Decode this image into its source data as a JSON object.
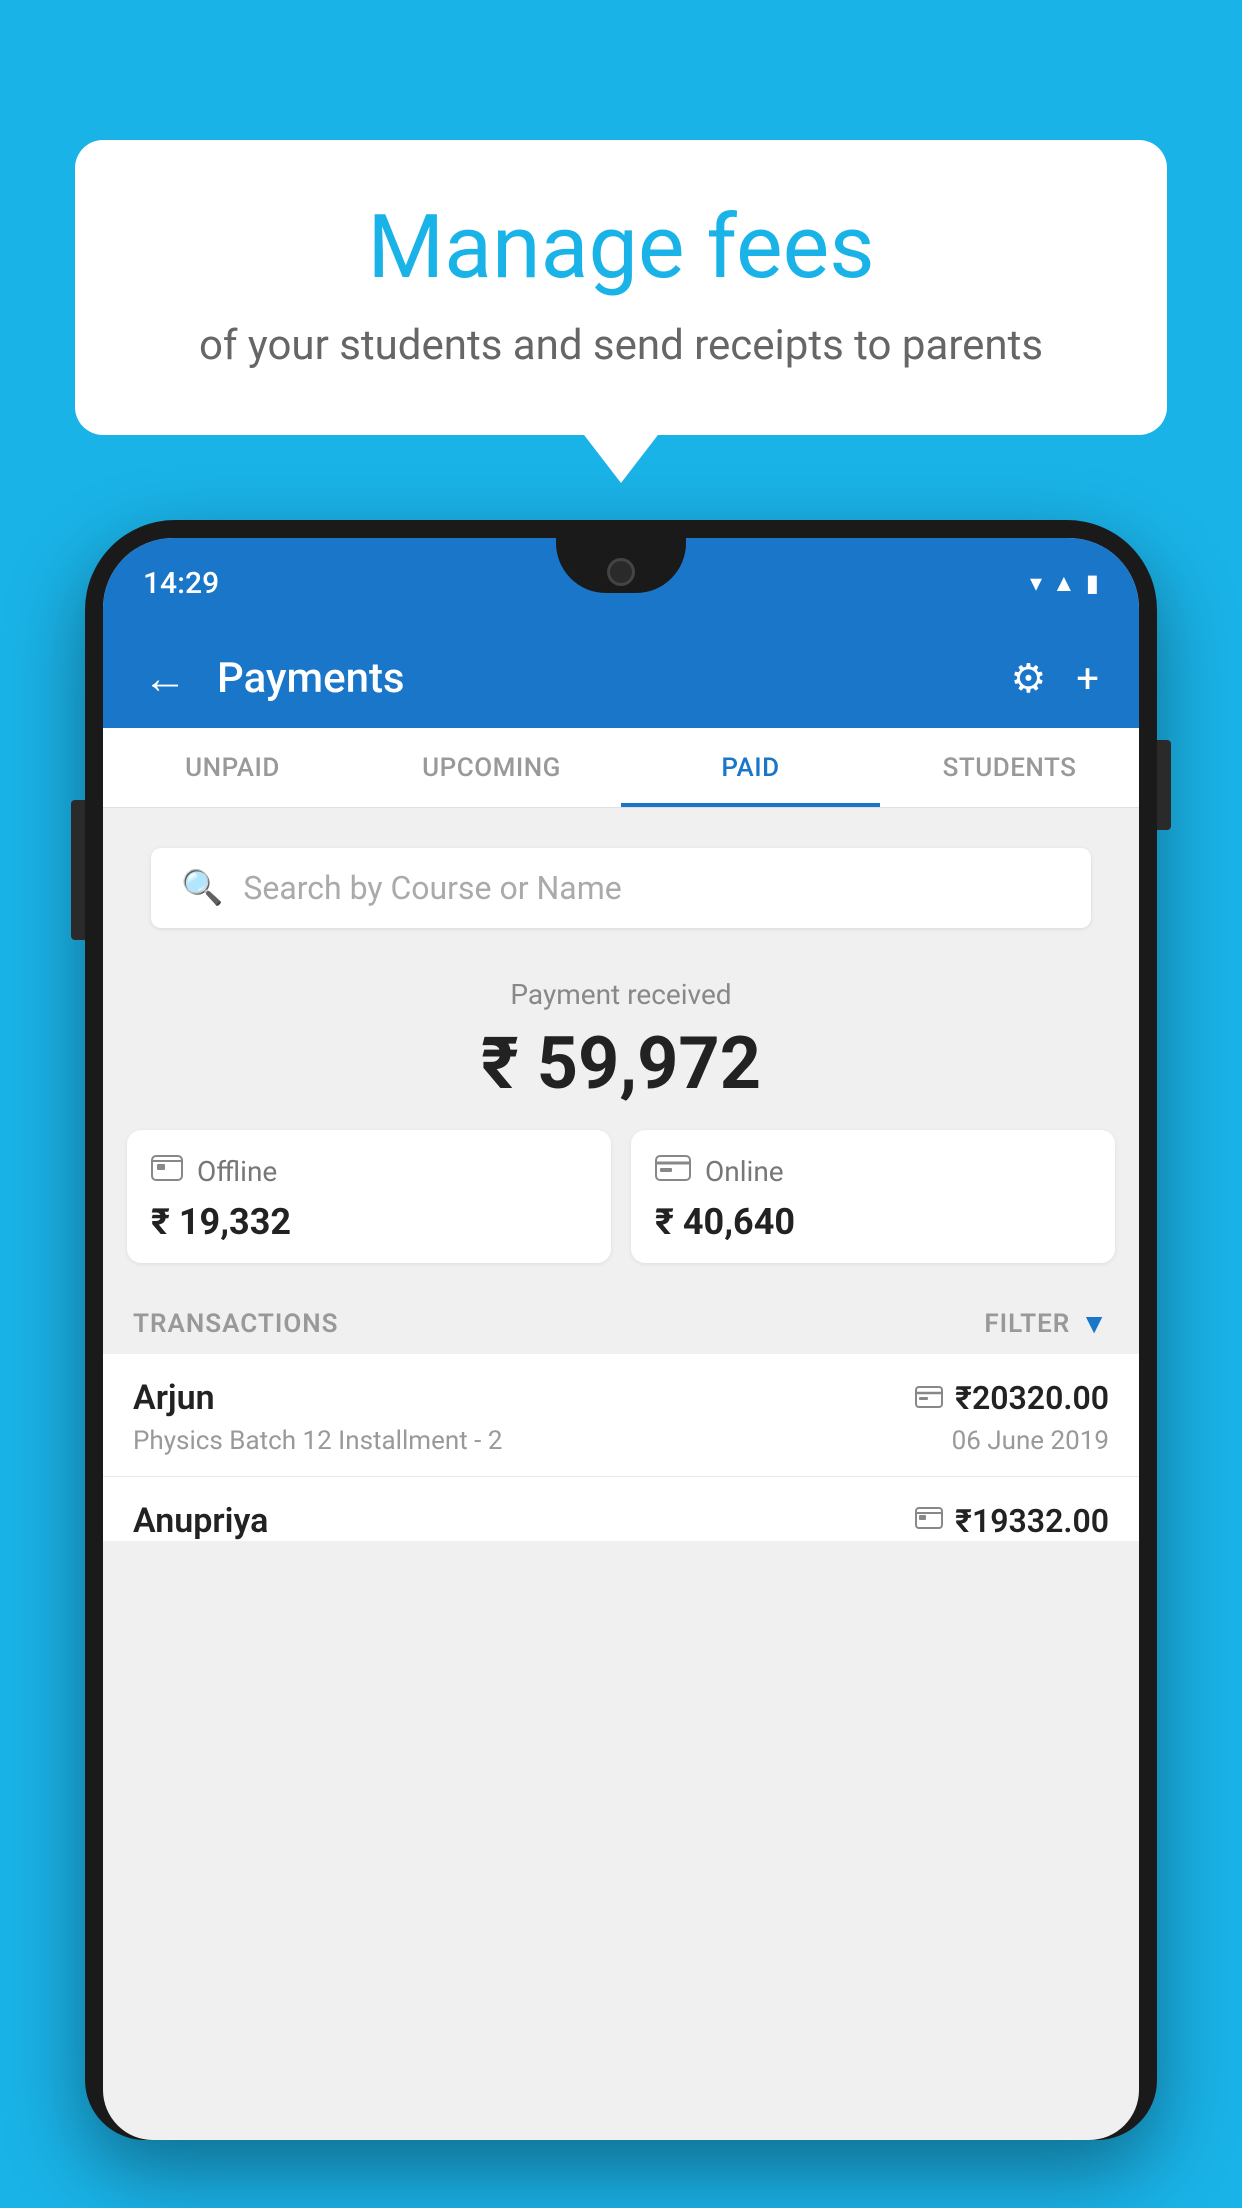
{
  "background_color": "#1ab3e8",
  "bubble": {
    "title": "Manage fees",
    "subtitle": "of your students and send receipts to parents"
  },
  "status_bar": {
    "time": "14:29",
    "icons": [
      "wifi",
      "signal",
      "battery"
    ]
  },
  "app_header": {
    "title": "Payments",
    "back_label": "←",
    "settings_label": "⚙",
    "add_label": "+"
  },
  "tabs": [
    {
      "id": "unpaid",
      "label": "UNPAID",
      "active": false
    },
    {
      "id": "upcoming",
      "label": "UPCOMING",
      "active": false
    },
    {
      "id": "paid",
      "label": "PAID",
      "active": true
    },
    {
      "id": "students",
      "label": "STUDENTS",
      "active": false
    }
  ],
  "search": {
    "placeholder": "Search by Course or Name"
  },
  "payment_summary": {
    "label": "Payment received",
    "total_amount": "₹ 59,972",
    "offline": {
      "label": "Offline",
      "amount": "₹ 19,332",
      "icon": "💳"
    },
    "online": {
      "label": "Online",
      "amount": "₹ 40,640",
      "icon": "💳"
    }
  },
  "transactions_section": {
    "header_label": "TRANSACTIONS",
    "filter_label": "FILTER"
  },
  "transactions": [
    {
      "name": "Arjun",
      "course": "Physics Batch 12 Installment - 2",
      "amount": "₹20320.00",
      "date": "06 June 2019",
      "payment_type": "online"
    },
    {
      "name": "Anupriya",
      "course": "",
      "amount": "₹19332.00",
      "date": "",
      "payment_type": "offline"
    }
  ]
}
